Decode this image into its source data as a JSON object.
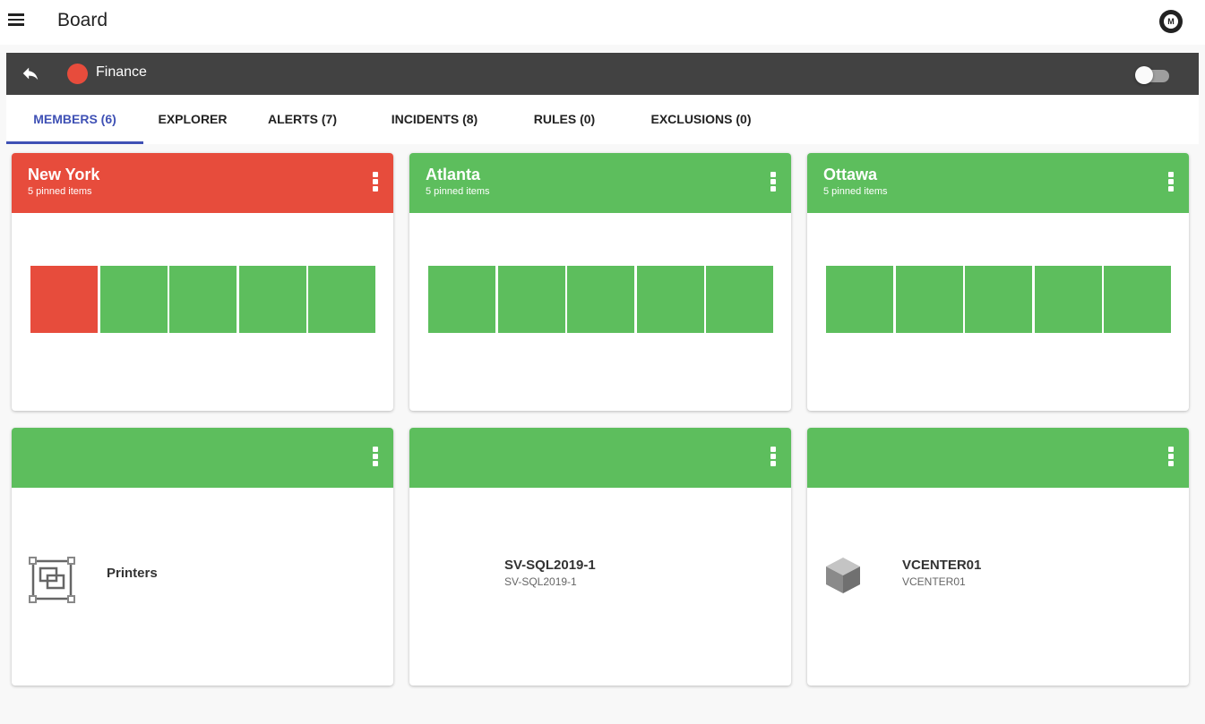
{
  "app": {
    "title": "Board"
  },
  "group": {
    "name": "Finance",
    "status_color": "#e74c3c",
    "toggle_on": false
  },
  "tabs": [
    {
      "label": "MEMBERS (6)",
      "active": true
    },
    {
      "label": "EXPLORER",
      "active": false
    },
    {
      "label": "ALERTS (7)",
      "active": false
    },
    {
      "label": "INCIDENTS (8)",
      "active": false
    },
    {
      "label": "RULES (0)",
      "active": false
    },
    {
      "label": "EXCLUSIONS (0)",
      "active": false
    }
  ],
  "colors": {
    "ok": "#5dbe5d",
    "error": "#e74c3c",
    "accent": "#3f51b5"
  },
  "cards": [
    {
      "title": "New York",
      "subtitle": "5 pinned items",
      "status": "error",
      "tiles": [
        "error",
        "ok",
        "ok",
        "ok",
        "ok"
      ]
    },
    {
      "title": "Atlanta",
      "subtitle": "5 pinned items",
      "status": "ok",
      "tiles": [
        "ok",
        "ok",
        "ok",
        "ok",
        "ok"
      ]
    },
    {
      "title": "Ottawa",
      "subtitle": "5 pinned items",
      "status": "ok",
      "tiles": [
        "ok",
        "ok",
        "ok",
        "ok",
        "ok"
      ]
    },
    {
      "title": "",
      "subtitle": "",
      "status": "ok",
      "member": {
        "name": "Printers",
        "sub": "",
        "icon": "group-icon"
      }
    },
    {
      "title": "",
      "subtitle": "",
      "status": "ok",
      "member": {
        "name": "SV-SQL2019-1",
        "sub": "SV-SQL2019-1",
        "icon": ""
      }
    },
    {
      "title": "",
      "subtitle": "",
      "status": "ok",
      "member": {
        "name": "VCENTER01",
        "sub": "VCENTER01",
        "icon": "cube-icon"
      }
    }
  ]
}
